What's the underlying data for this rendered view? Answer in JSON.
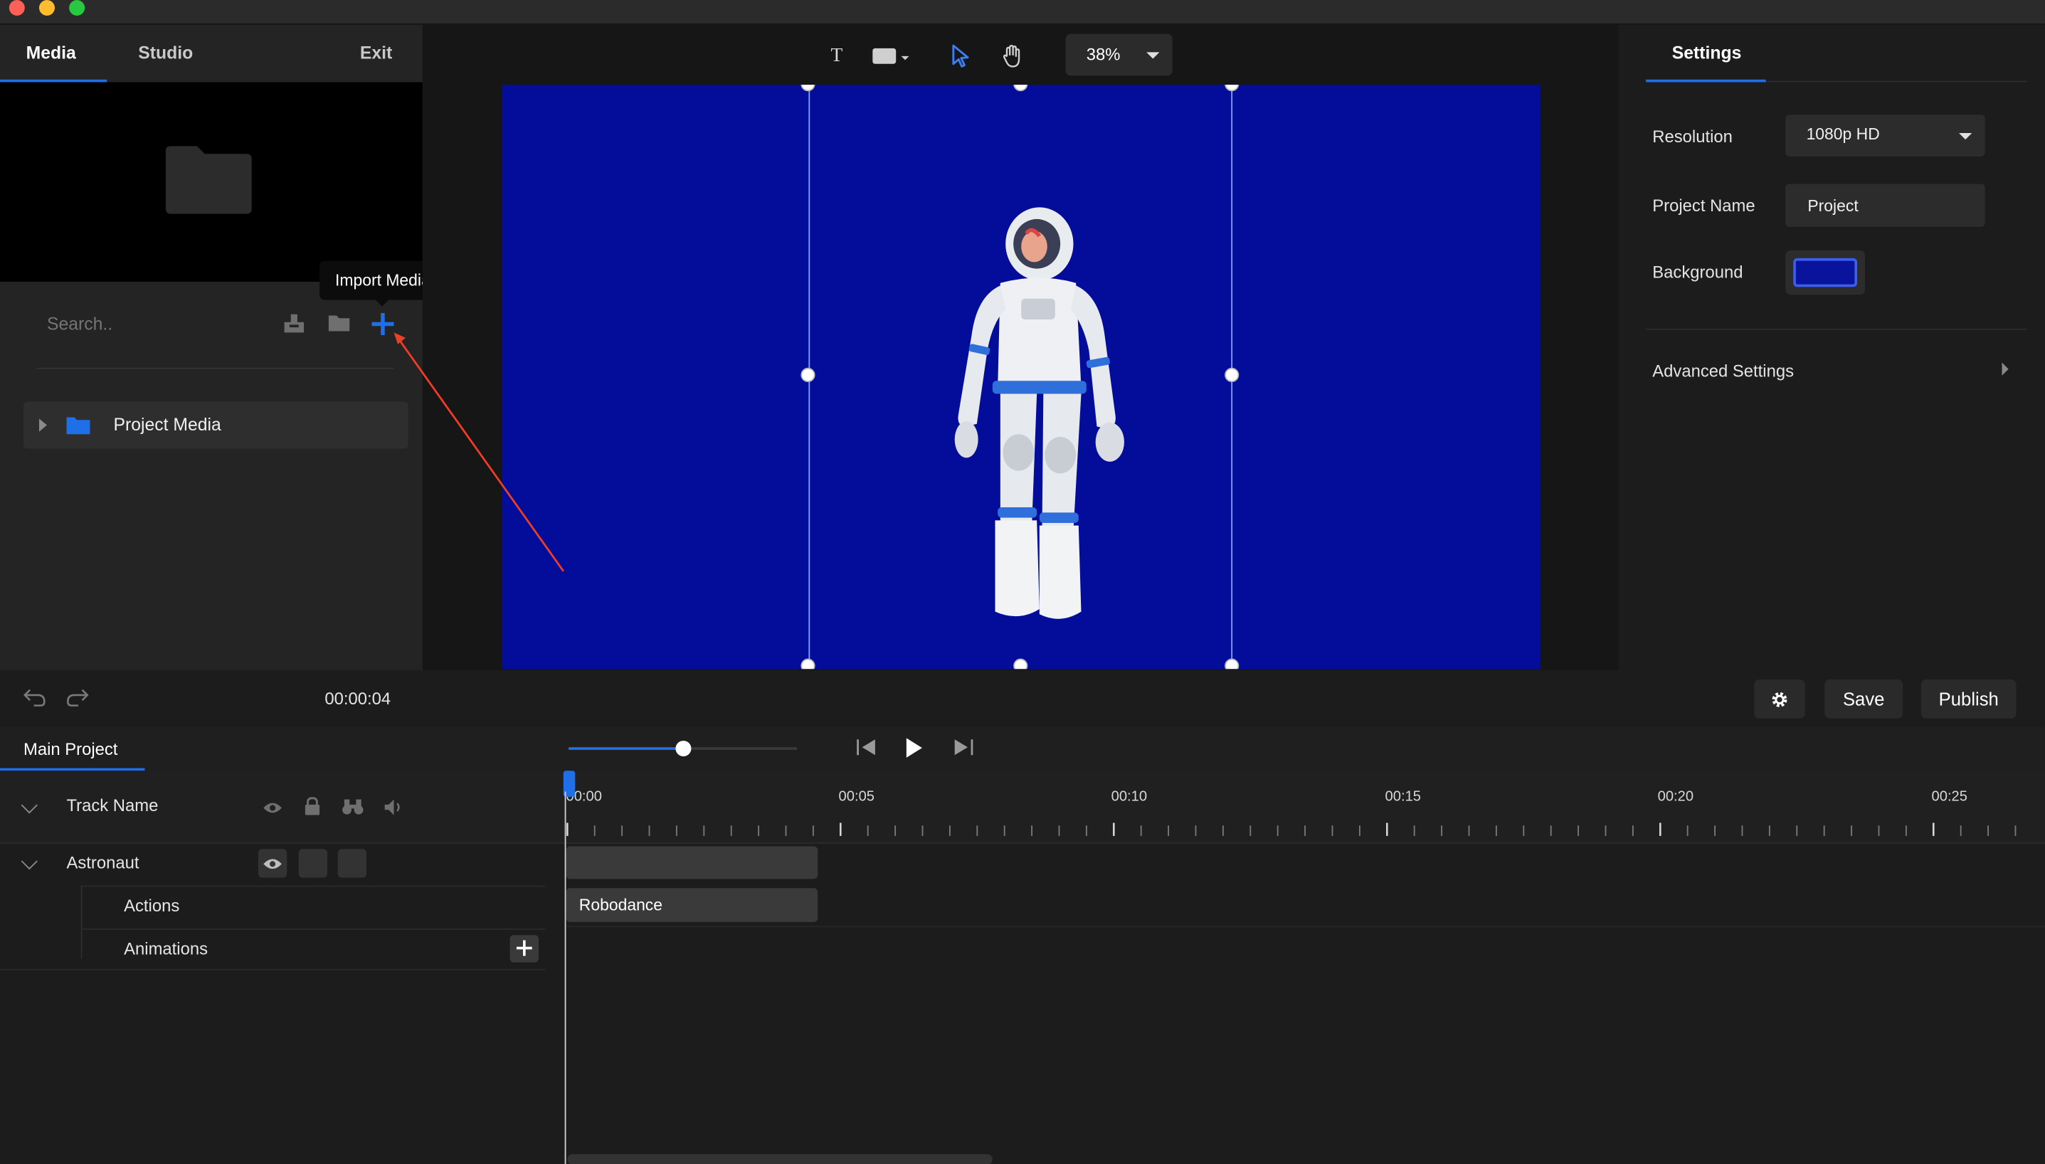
{
  "left_panel": {
    "tabs": {
      "media": "Media",
      "studio": "Studio",
      "exit": "Exit"
    },
    "tooltip": "Import Media",
    "search": {
      "placeholder": "Search..",
      "value": ""
    },
    "tree": {
      "project_media": "Project Media"
    }
  },
  "toolbar": {
    "zoom": "38%"
  },
  "settings": {
    "tab": "Settings",
    "resolution_label": "Resolution",
    "resolution_value": "1080p HD",
    "project_name_label": "Project Name",
    "project_name_value": "Project",
    "background_label": "Background",
    "background_color": "#0a139c",
    "advanced_label": "Advanced Settings"
  },
  "bottom_bar": {
    "time": "00:00:04",
    "save": "Save",
    "publish": "Publish"
  },
  "timeline": {
    "tab": "Main Project",
    "header_label": "Track Name",
    "tracks": [
      {
        "name": "Astronaut"
      },
      {
        "name": "Actions"
      },
      {
        "name": "Animations"
      }
    ],
    "ruler_labels": [
      "00:00",
      "00:05",
      "00:10",
      "00:15",
      "00:20",
      "00:25"
    ],
    "clip_label": "Robodance",
    "playhead_progress": 0.5
  },
  "colors": {
    "accent": "#1f6fe8",
    "canvas_bg": "#030d9a"
  }
}
